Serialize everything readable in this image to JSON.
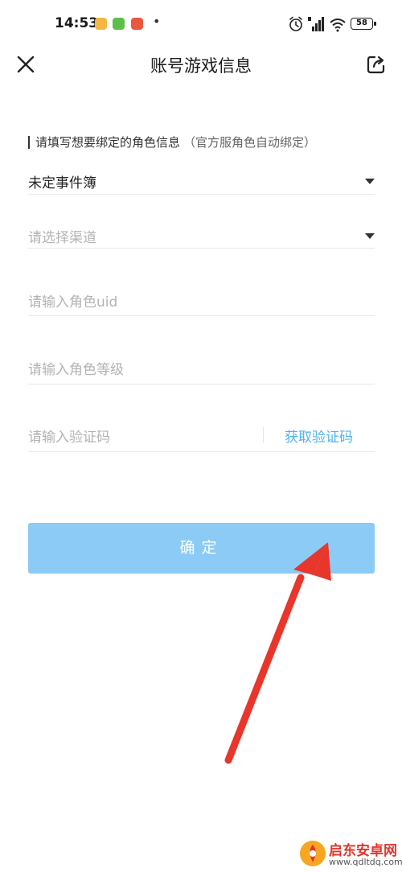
{
  "status_bar": {
    "time": "14:53",
    "dot": "•",
    "battery": "58",
    "icons": [
      "notes-app-icon",
      "download-app-icon",
      "news-app-icon",
      "alarm-icon",
      "signal-icon",
      "wifi-icon",
      "battery-icon"
    ]
  },
  "header": {
    "title": "账号游戏信息",
    "close_icon": "close-icon",
    "share_icon": "share-icon"
  },
  "form": {
    "section_label": "请填写想要绑定的角色信息",
    "section_note": "（官方服角色自动绑定）",
    "game_select": {
      "value": "未定事件簿"
    },
    "channel_select": {
      "placeholder": "请选择渠道"
    },
    "uid_input": {
      "placeholder": "请输入角色uid"
    },
    "level_input": {
      "placeholder": "请输入角色等级"
    },
    "code_input": {
      "placeholder": "请输入验证码"
    },
    "get_code_label": "获取验证码",
    "confirm_label": "确定"
  },
  "watermark": {
    "title": "启东安卓网",
    "url": "www.qdltdq.com"
  },
  "colors": {
    "accent": "#4fb3ee",
    "button_bg": "#8bcbf5",
    "annotation_arrow": "#e8362b"
  }
}
